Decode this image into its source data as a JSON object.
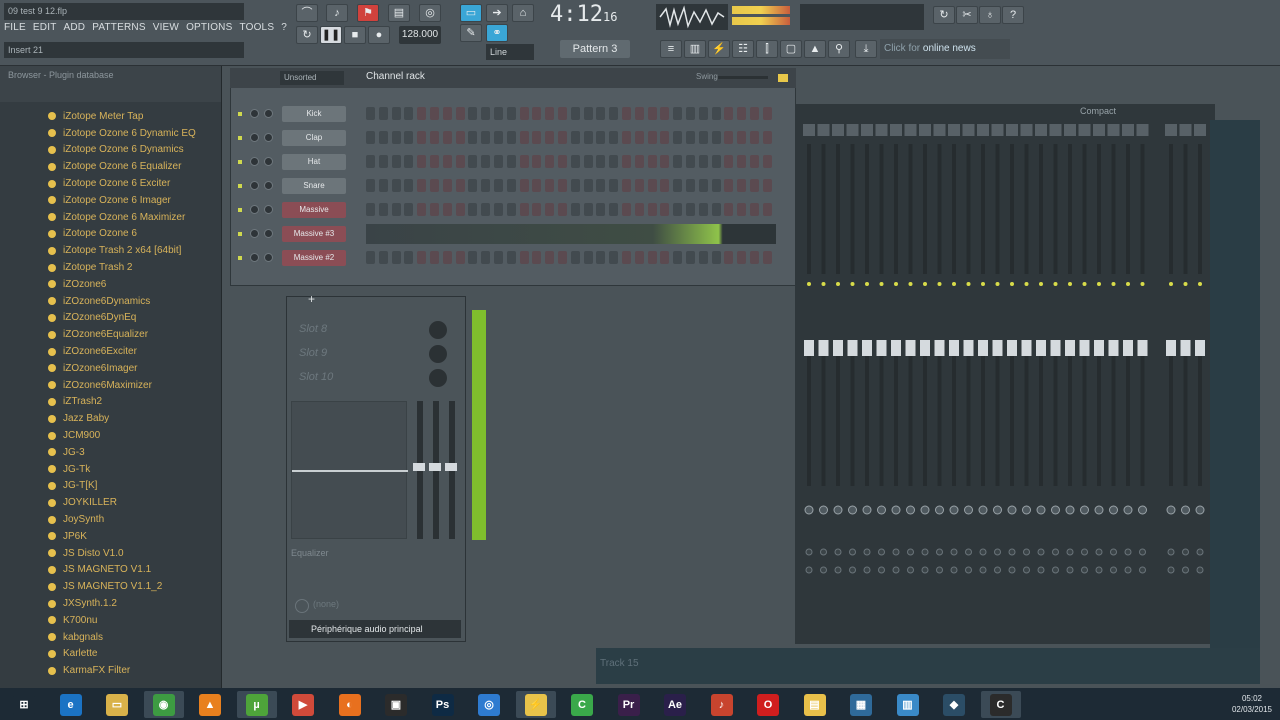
{
  "window": {
    "title": "09 test 9 12.flp",
    "hint": "Insert 21"
  },
  "menu": [
    "FILE",
    "EDIT",
    "ADD",
    "PATTERNS",
    "VIEW",
    "OPTIONS",
    "TOOLS",
    "?"
  ],
  "transport": {
    "time_main": "4:12",
    "time_sub": "16",
    "tempo": "128.000",
    "pattern": "Pattern 3",
    "snap": "Line"
  },
  "news": {
    "prefix": "Click for",
    "label": "online news"
  },
  "browser": {
    "title": "Browser - Plugin database",
    "plugins": [
      "iZotope Meter Tap",
      "iZotope Ozone 6 Dynamic EQ",
      "iZotope Ozone 6 Dynamics",
      "iZotope Ozone 6 Equalizer",
      "iZotope Ozone 6 Exciter",
      "iZotope Ozone 6 Imager",
      "iZotope Ozone 6 Maximizer",
      "iZotope Ozone 6",
      "iZotope Trash 2 x64 [64bit]",
      "iZotope Trash 2",
      "iZOzone6",
      "iZOzone6Dynamics",
      "iZOzone6DynEq",
      "iZOzone6Equalizer",
      "iZOzone6Exciter",
      "iZOzone6Imager",
      "iZOzone6Maximizer",
      "iZTrash2",
      "Jazz Baby",
      "JCM900",
      "JG-3",
      "JG-Tk",
      "JG-T[K]",
      "JOYKILLER",
      "JoySynth",
      "JP6K",
      "JS Disto V1.0",
      "JS MAGNETO V1.1",
      "JS MAGNETO V1.1_2",
      "JXSynth.1.2",
      "K700nu",
      "kabgnals",
      "Karlette",
      "KarmaFX Filter"
    ]
  },
  "channel_rack": {
    "title": "Channel rack",
    "filter": "Unsorted",
    "swing_label": "Swing",
    "channels": [
      {
        "name": "Kick",
        "red": false
      },
      {
        "name": "Clap",
        "red": false
      },
      {
        "name": "Hat",
        "red": false
      },
      {
        "name": "Snare",
        "red": false
      },
      {
        "name": "Massive",
        "red": true
      },
      {
        "name": "Massive #3",
        "red": true
      },
      {
        "name": "Massive #2",
        "red": true
      }
    ]
  },
  "mixer": {
    "view": "Compact",
    "slots": [
      "Slot 8",
      "Slot 9",
      "Slot 10"
    ],
    "equalizer_label": "Equalizer",
    "none_label": "(none)",
    "device": "Périphérique audio principal"
  },
  "playlist": {
    "track_label": "Track 15"
  },
  "taskbar": {
    "items": [
      "Win",
      "IE",
      "Explorer",
      "Globe",
      "VLC",
      "uTorrent",
      "Media",
      "Firefox",
      "Box",
      "Ps",
      "Chrome",
      "Bolt",
      "C",
      "Pr",
      "Ae",
      "Guitar",
      "Opera",
      "Folder",
      "Net",
      "Docs",
      "Shield",
      "C2"
    ],
    "time": "05:02",
    "date": "02/03/2015"
  },
  "colors": {
    "accent_green": "#7fbe2d",
    "plugin_text": "#d8b35a",
    "record_red": "#d0423d"
  }
}
